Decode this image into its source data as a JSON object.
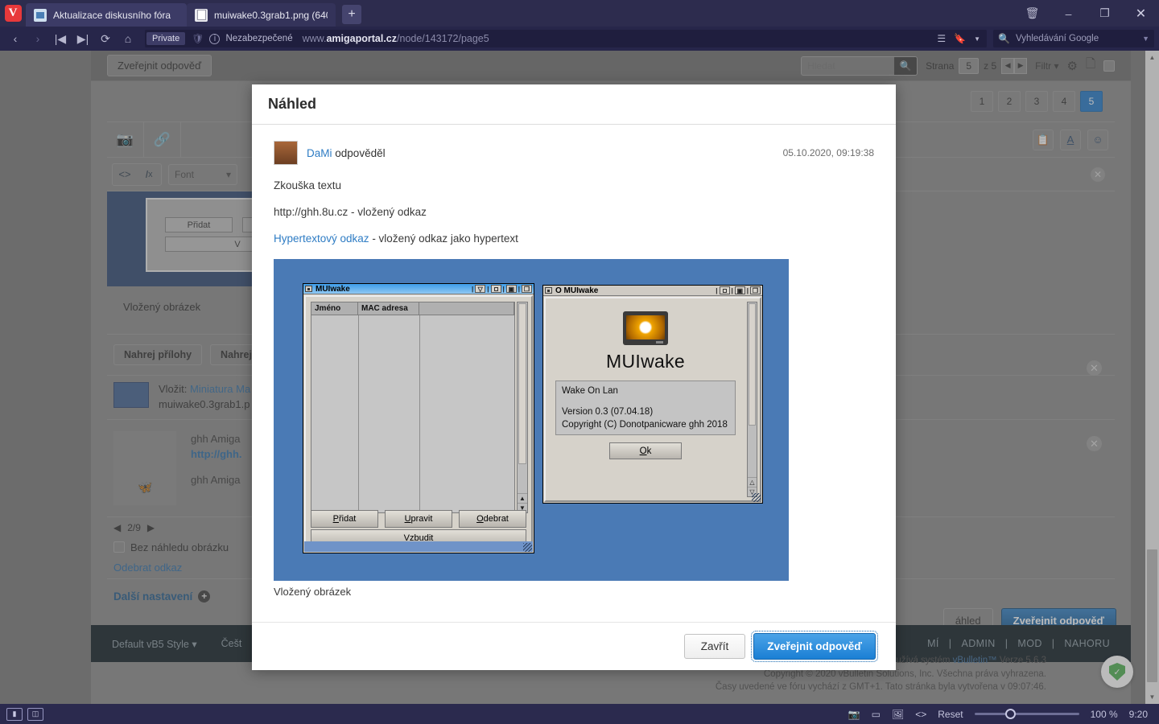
{
  "browser": {
    "tabs": [
      {
        "title": "Aktualizace diskusního fóra",
        "favicon": "image-favicon",
        "active": true
      },
      {
        "title": "muiwake0.3grab1.png (640",
        "favicon": "document-favicon",
        "active": false
      }
    ],
    "new_tab_label": "+",
    "window_controls": {
      "trash": "🗑",
      "minimize": "–",
      "maximize": "❐",
      "close": "✕"
    },
    "nav": {
      "back": "‹",
      "forward": "›",
      "rewind": "|◀",
      "fastforward": "▶|",
      "reload": "⟳",
      "home": "⌂"
    },
    "address": {
      "private_badge": "Private",
      "security_label": "Nezabezpečené",
      "url_prefix": "www.",
      "url_domain": "amigaportal.cz",
      "url_path": "/node/143172/page5"
    },
    "search_box": {
      "placeholder": "Vyhledávání Google"
    }
  },
  "forum": {
    "post_reply_button": "Zveřejnit odpověď",
    "search": {
      "placeholder": "Hledat"
    },
    "pagination": {
      "label": "Strana",
      "current": "5",
      "of_label": "z 5",
      "prev": "◀",
      "next": "▶"
    },
    "filter_label": "Filtr",
    "page_numbers": [
      "1",
      "2",
      "3",
      "4",
      "5"
    ],
    "active_page": "5",
    "editor": {
      "font_label": "Font",
      "image_caption_1": "Vložený obrázek",
      "attach_buttons": [
        "Nahrej přílohy",
        "Nahrej"
      ],
      "attach_prefix": "Vložit:",
      "attach_link_1": "Miniatura",
      "attach_link_2": "Ma",
      "attach_filename": "muiwake0.3grab1.p",
      "link_card": {
        "title": "ghh Amiga",
        "url": "http://ghh.",
        "desc": "ghh Amiga",
        "counter": "2/9",
        "prev": "◀",
        "next": "▶"
      },
      "no_preview_label": "Bez náhledu obrázku",
      "remove_link_label": "Odebrat odkaz",
      "more_settings_label": "Další nastavení",
      "preview_button": "áhled",
      "submit_button": "Zveřejnit odpověď"
    },
    "footer": {
      "style_selector": "Default vB5 Style",
      "language_selector": "Češt",
      "links": [
        "MÍ",
        "ADMIN",
        "MOD",
        "NAHORU"
      ],
      "legal_line1_a": "Toto diskuzní fórum využívá systém ",
      "legal_line1_b": "vBulletin™",
      "legal_line1_c": " Verze 5.6.3",
      "legal_line2": "Copyright © 2020 vBulletin Solutions, Inc. Všechna práva vyhrazena.",
      "legal_line3": "Časy uvedené ve fóru vychází z GMT+1. Tato stránka byla vytvořena v 09:07:46."
    }
  },
  "modal": {
    "title": "Náhled",
    "post": {
      "author": "DaMi",
      "action": "odpověděl",
      "timestamp": "05.10.2020, 09:19:38",
      "paragraphs": [
        {
          "text": "Zkouška textu"
        },
        {
          "text": "http://ghh.8u.cz - vložený odkaz"
        }
      ],
      "link_line": {
        "link": "Hypertextový odkaz",
        "rest": " - vložený odkaz jako hypertext"
      },
      "image_caption": "Vložený obrázek"
    },
    "buttons": {
      "close": "Zavřít",
      "submit": "Zveřejnit odpověď"
    }
  },
  "embedded_image": {
    "background_color": "#4a7ab5",
    "main_window": {
      "title": "MUIwake",
      "columns": [
        "Jméno",
        "MAC adresa"
      ],
      "rows": [],
      "buttons": [
        "Přidat",
        "Upravit",
        "Odebrat"
      ],
      "wake_button": "Vzbudit",
      "gadget_icons": [
        "iconify-gadget",
        "snapshot-gadget",
        "zoom-gadget",
        "depth-gadget"
      ]
    },
    "about_window": {
      "title": "O MUIwake",
      "app_name": "MUIwake",
      "description": "Wake On Lan",
      "version": "Version 0.3 (07.04.18)",
      "copyright": "Copyright (C) Donotpanicware ghh 2018",
      "ok_button": "Ok"
    }
  },
  "taskbar": {
    "left_icons": [
      "panel-toggle-icon",
      "tiling-icon"
    ],
    "right_icons": [
      "capture-page-icon",
      "capture-area-icon",
      "image-icon",
      "developer-tools-icon"
    ],
    "reset_label": "Reset",
    "zoom_level": "100 %",
    "clock": "9:20"
  }
}
